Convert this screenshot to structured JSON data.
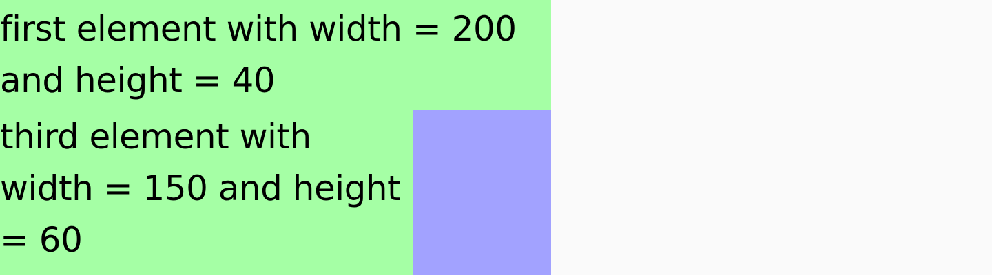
{
  "elements": {
    "first": {
      "text": "first element with width = 200 and height = 40"
    },
    "third": {
      "text": "third element with width = 150 and height = 60"
    }
  },
  "colors": {
    "page_background": "#fafafa",
    "container_background": "#a5ffa5",
    "side_box_background": "#a2a2ff",
    "text": "#000000"
  }
}
